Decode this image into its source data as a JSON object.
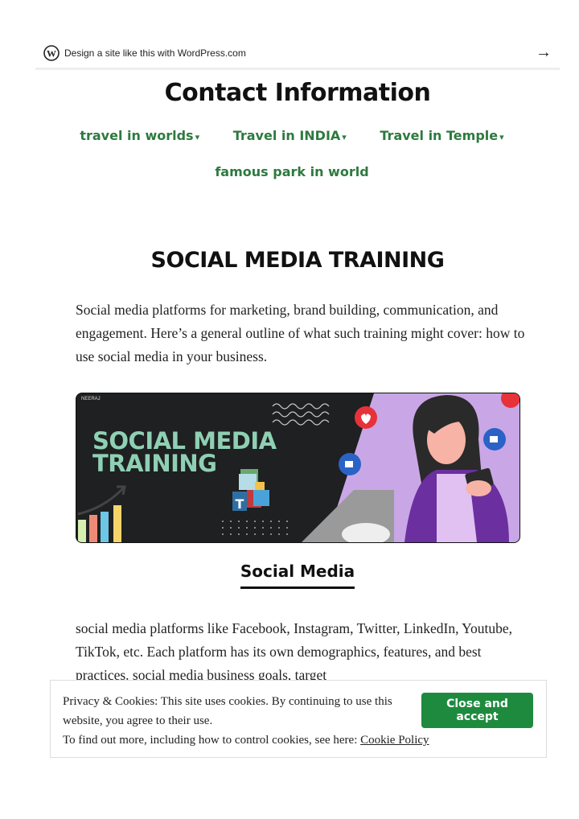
{
  "wordpress_bar": {
    "text": "Design a site like this with WordPress.com",
    "arrow": "→"
  },
  "site_title": "Contact Information",
  "nav": {
    "items": [
      {
        "label": "travel in worlds",
        "has_dropdown": true
      },
      {
        "label": "Travel in INDIA",
        "has_dropdown": true
      },
      {
        "label": "Travel in Temple",
        "has_dropdown": true
      },
      {
        "label": "famous park in world",
        "has_dropdown": false
      }
    ],
    "dropdown_glyph": "▾"
  },
  "post": {
    "title": "SOCIAL MEDIA TRAINING",
    "intro": "Social media platforms for marketing, brand building, communication, and engagement. Here’s a general outline of what such training might cover: how to use social media in your business.",
    "banner": {
      "brand": "NEERAJ",
      "title_line1": "SOCIAL MEDIA",
      "title_line2": "TRAINING"
    },
    "subheading": "Social Media",
    "body": "social media platforms like Facebook, Instagram, Twitter, LinkedIn, Youtube, TikTok, etc. Each platform has its own demographics, features, and best practices. social media business goals, target"
  },
  "cookie_banner": {
    "line1": "Privacy & Cookies: This site uses cookies. By continuing to use this website, you agree to their use.",
    "line2_prefix": "To find out more, including how to control cookies, see here: ",
    "policy_link": "Cookie Policy",
    "accept_button": "Close and accept"
  },
  "colors": {
    "nav_green": "#2d7a3f",
    "button_green": "#1e8a3e",
    "banner_teal": "#8fd0b4"
  }
}
